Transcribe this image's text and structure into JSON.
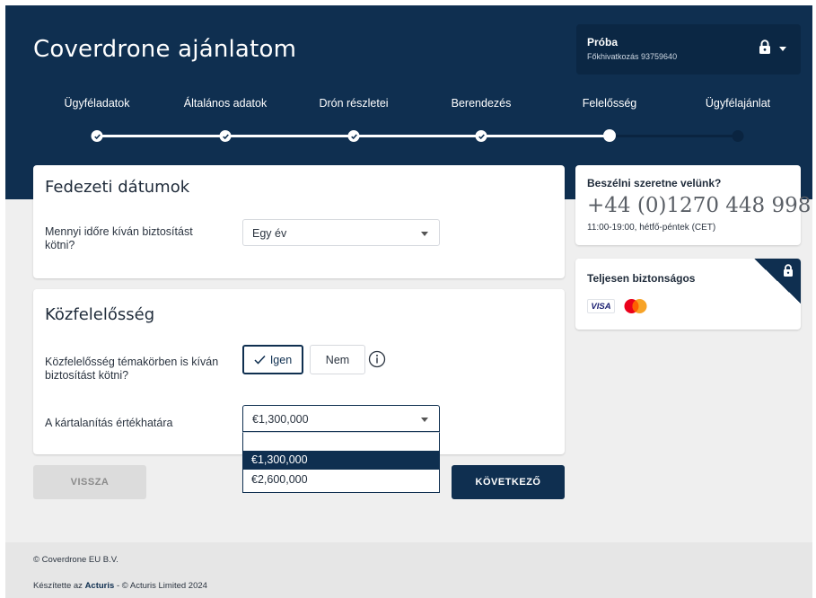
{
  "header": {
    "title": "Coverdrone ajánlatom",
    "account": {
      "name": "Próba",
      "subtitle": "Főkhivatkozás 93759640",
      "icon": "lock-icon",
      "menu_icon": "caret-down-icon"
    }
  },
  "steps": [
    {
      "label": "Ügyféladatok",
      "state": "done"
    },
    {
      "label": "Általános adatok",
      "state": "done"
    },
    {
      "label": "Drón részletei",
      "state": "done"
    },
    {
      "label": "Berendezés",
      "state": "done"
    },
    {
      "label": "Felelősség",
      "state": "current"
    },
    {
      "label": "Ügyfélajánlat",
      "state": "todo"
    }
  ],
  "coverage_dates": {
    "title": "Fedezeti dátumok",
    "question": "Mennyi időre kíván biztosítást kötni?",
    "selected": "Egy év"
  },
  "liability": {
    "title": "Közfelelősség",
    "question": "Közfelelősség témakörben is kíván biztosítást kötni?",
    "yes_label": "Igen",
    "no_label": "Nem",
    "yes_selected": true,
    "limit_label": "A kártalanítás értékhatára",
    "limit_selected": "€1,300,000",
    "limit_options": [
      "€1,300,000",
      "€2,600,000"
    ]
  },
  "nav": {
    "back_label": "VISSZA",
    "next_label": "KÖVETKEZŐ"
  },
  "contact": {
    "title": "Beszélni szeretne velünk?",
    "phone": "+44 (0)1270 448 998",
    "hours": "11:00-19:00, hétfő-péntek (CET)"
  },
  "security": {
    "title": "Teljesen biztonságos",
    "visa_label": "VISA",
    "cards": [
      "visa-icon",
      "mastercard-icon"
    ]
  },
  "footer": {
    "copyright": "© Coverdrone EU B.V.",
    "made_prefix": "Készítette az",
    "made_brand": "Acturis",
    "made_suffix": "- © Acturis Limited 2024"
  },
  "colors": {
    "brand_navy": "#0f2f50",
    "background": "#efefef",
    "card": "#ffffff"
  }
}
